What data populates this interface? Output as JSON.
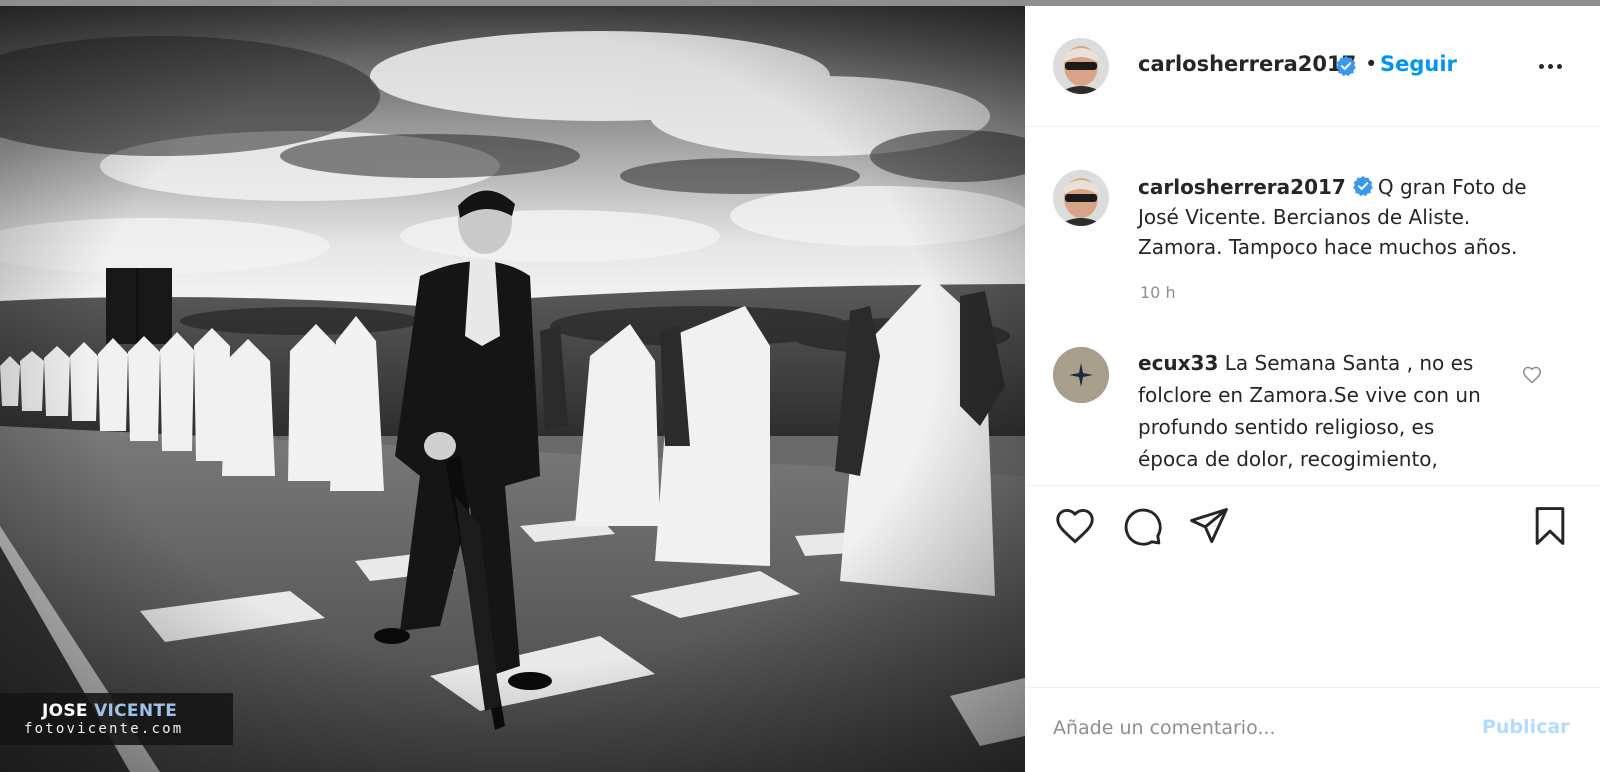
{
  "colors": {
    "accent": "#0095f6",
    "publish_disabled": "#b3dbff",
    "muted_text": "#8e8e8e",
    "text": "#262626",
    "divider": "#efefef"
  },
  "photo": {
    "description_icon": "photo-image",
    "watermark": {
      "line1_a": "JOSE",
      "line1_b": "VICENTE",
      "line2": "fotovicente.com"
    }
  },
  "header": {
    "username": "carlosherrera2017",
    "verified_icon": "verified-badge-icon",
    "dot": "•",
    "follow_label": "Seguir",
    "more_icon": "more-options-icon"
  },
  "caption": {
    "username": "carlosherrera2017",
    "text": "Q gran Foto de José Vicente. Bercianos de Aliste. Zamora. Tampoco hace muchos años.",
    "time": "10 h"
  },
  "comments": [
    {
      "username": "ecux33",
      "text": "La Semana Santa , no es folclore en Zamora.Se vive con un profundo sentido religioso, es época de dolor, recogimiento,",
      "like_icon": "heart-outline-icon"
    }
  ],
  "actions": {
    "like_icon": "heart-outline-icon",
    "comment_icon": "comment-bubble-icon",
    "share_icon": "paper-plane-icon",
    "save_icon": "bookmark-icon"
  },
  "add_comment": {
    "placeholder": "Añade un comentario...",
    "publish_label": "Publicar"
  }
}
